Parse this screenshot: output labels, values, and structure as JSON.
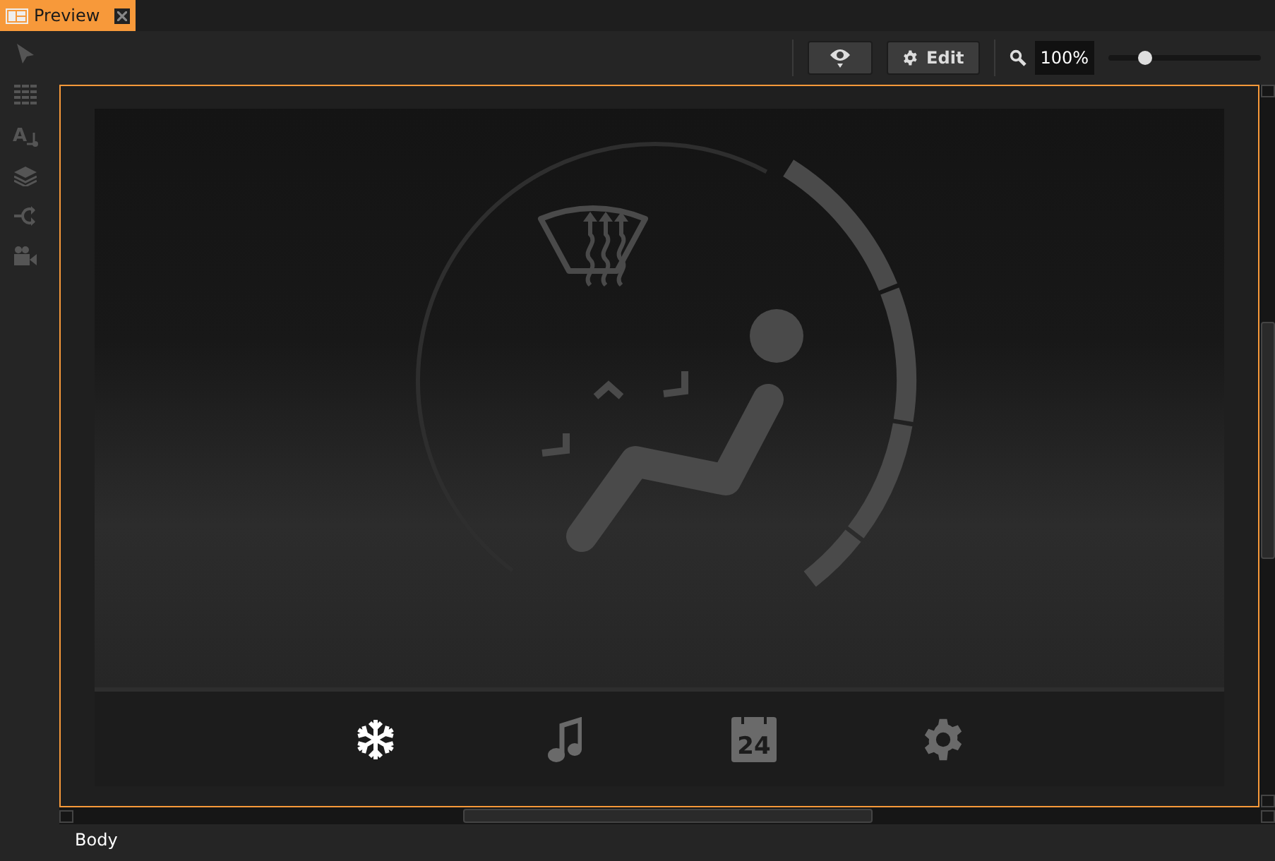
{
  "tabs": [
    {
      "label": "Preview",
      "selected": true
    }
  ],
  "text_tool_glyph": "A",
  "toolbar": {
    "edit_button": "Edit",
    "zoom": {
      "value": "100%",
      "level": 0.24
    }
  },
  "nav": [
    {
      "kind": "snowflake",
      "selected": true
    },
    {
      "kind": "music",
      "selected": false
    },
    {
      "kind": "calendar",
      "text": "24",
      "selected": false
    },
    {
      "kind": "gear",
      "selected": false
    }
  ],
  "status_bar": "Body"
}
